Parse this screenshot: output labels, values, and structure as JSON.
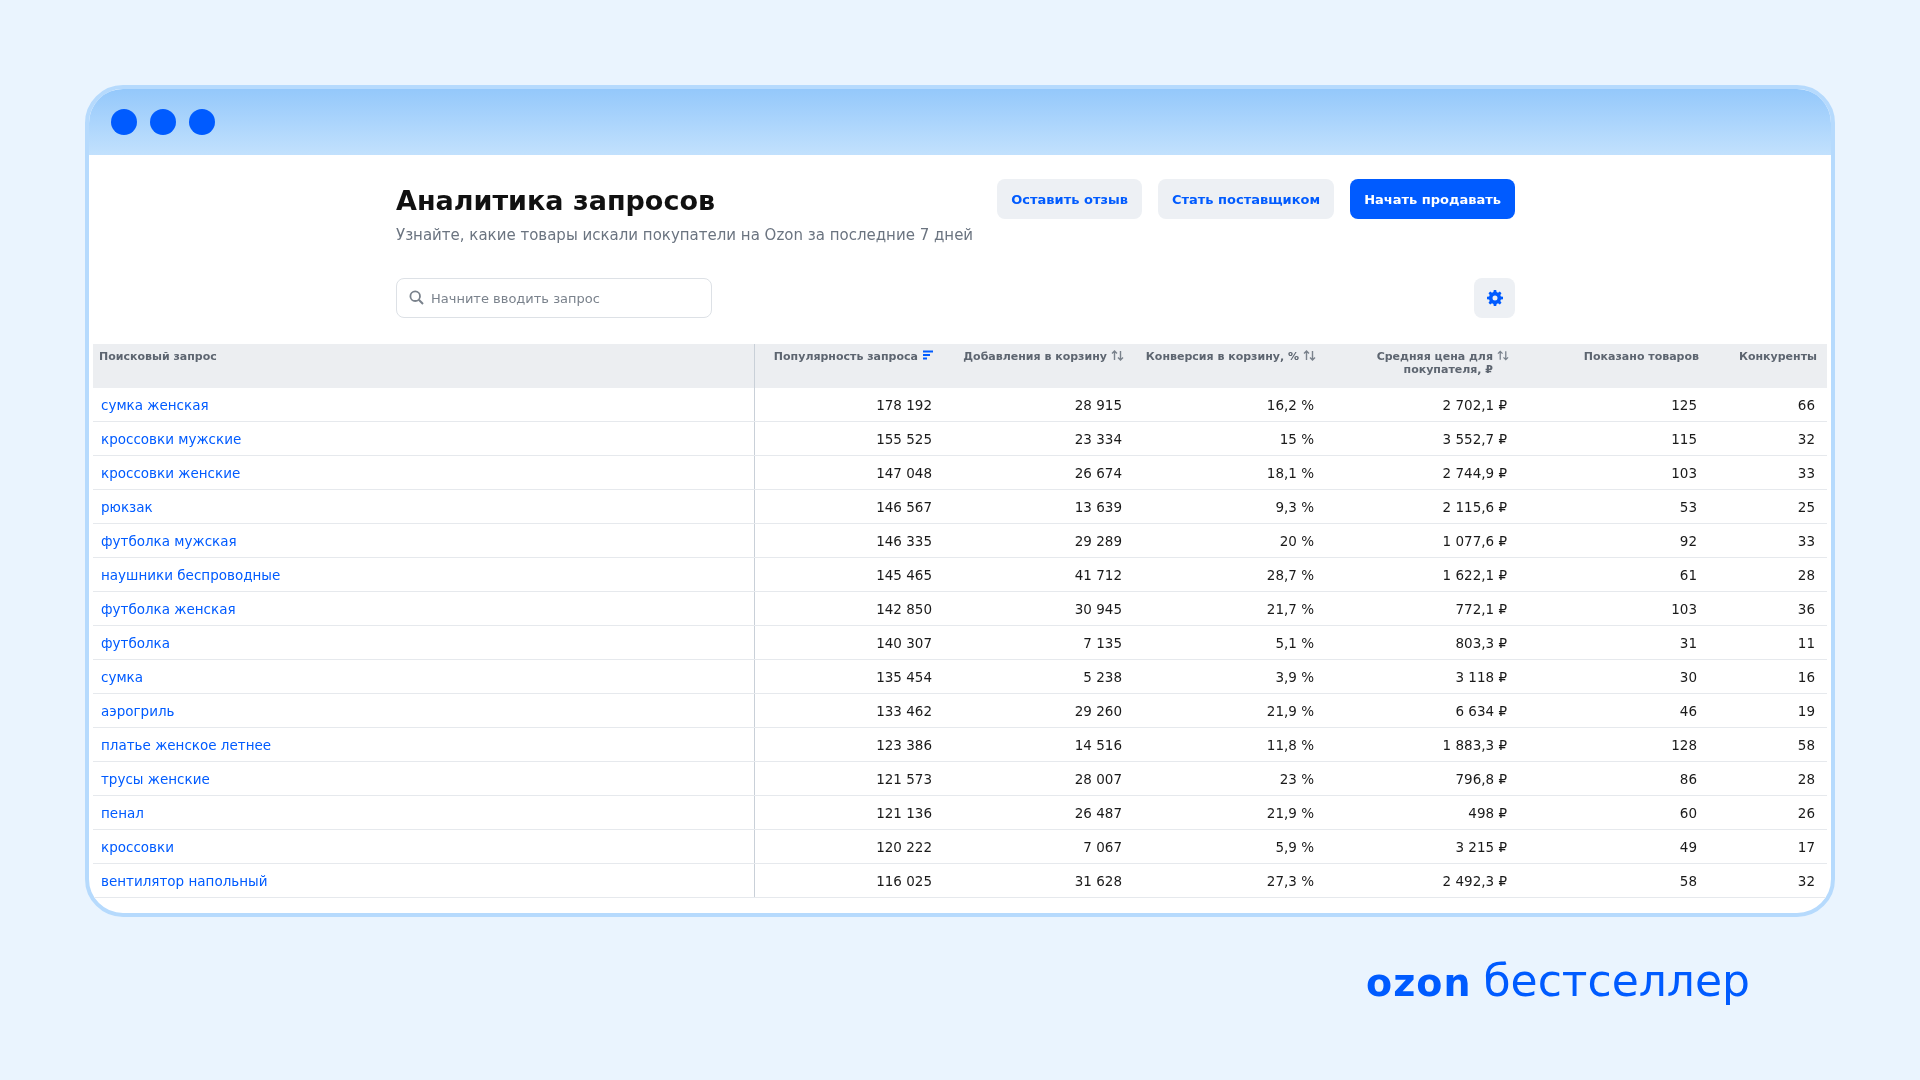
{
  "page": {
    "title": "Аналитика запросов",
    "subtitle": "Узнайте, какие товары искали покупатели на Ozon за последние 7 дней"
  },
  "buttons": [
    {
      "label": "Оставить отзыв",
      "kind": "secondary"
    },
    {
      "label": "Стать поставщиком",
      "kind": "secondary"
    },
    {
      "label": "Начать продавать",
      "kind": "primary"
    }
  ],
  "search": {
    "placeholder": "Начните вводить запрос"
  },
  "table": {
    "columns": [
      {
        "label": "Поисковый запрос",
        "sortable": false,
        "sorted": false
      },
      {
        "label": "Популярность запроса",
        "sortable": true,
        "sorted": true
      },
      {
        "label": "Добавления в корзину",
        "sortable": true,
        "sorted": false
      },
      {
        "label": "Конверсия в корзину, %",
        "sortable": true,
        "sorted": false
      },
      {
        "label": "Средняя цена для покупателя, ₽",
        "sortable": true,
        "sorted": false
      },
      {
        "label": "Показано товаров",
        "sortable": false,
        "sorted": false
      },
      {
        "label": "Конкуренты",
        "sortable": false,
        "sorted": false
      }
    ],
    "rows": [
      [
        "сумка женская",
        "178 192",
        "28 915",
        "16,2 %",
        "2 702,1 ₽",
        "125",
        "66"
      ],
      [
        "кроссовки мужские",
        "155 525",
        "23 334",
        "15 %",
        "3 552,7 ₽",
        "115",
        "32"
      ],
      [
        "кроссовки женские",
        "147 048",
        "26 674",
        "18,1 %",
        "2 744,9 ₽",
        "103",
        "33"
      ],
      [
        "рюкзак",
        "146 567",
        "13 639",
        "9,3 %",
        "2 115,6 ₽",
        "53",
        "25"
      ],
      [
        "футболка мужская",
        "146 335",
        "29 289",
        "20 %",
        "1 077,6 ₽",
        "92",
        "33"
      ],
      [
        "наушники беспроводные",
        "145 465",
        "41 712",
        "28,7 %",
        "1 622,1 ₽",
        "61",
        "28"
      ],
      [
        "футболка женская",
        "142 850",
        "30 945",
        "21,7 %",
        "772,1 ₽",
        "103",
        "36"
      ],
      [
        "футболка",
        "140 307",
        "7 135",
        "5,1 %",
        "803,3 ₽",
        "31",
        "11"
      ],
      [
        "сумка",
        "135 454",
        "5 238",
        "3,9 %",
        "3 118 ₽",
        "30",
        "16"
      ],
      [
        "аэрогриль",
        "133 462",
        "29 260",
        "21,9 %",
        "6 634 ₽",
        "46",
        "19"
      ],
      [
        "платье женское летнее",
        "123 386",
        "14 516",
        "11,8 %",
        "1 883,3 ₽",
        "128",
        "58"
      ],
      [
        "трусы женские",
        "121 573",
        "28 007",
        "23 %",
        "796,8 ₽",
        "86",
        "28"
      ],
      [
        "пенал",
        "121 136",
        "26 487",
        "21,9 %",
        "498 ₽",
        "60",
        "26"
      ],
      [
        "кроссовки",
        "120 222",
        "7 067",
        "5,9 %",
        "3 215 ₽",
        "49",
        "17"
      ],
      [
        "вентилятор напольный",
        "116 025",
        "31 628",
        "27,3 %",
        "2 492,3 ₽",
        "58",
        "32"
      ]
    ]
  },
  "brand": {
    "logo": "ozon",
    "name": "бестселлер"
  }
}
